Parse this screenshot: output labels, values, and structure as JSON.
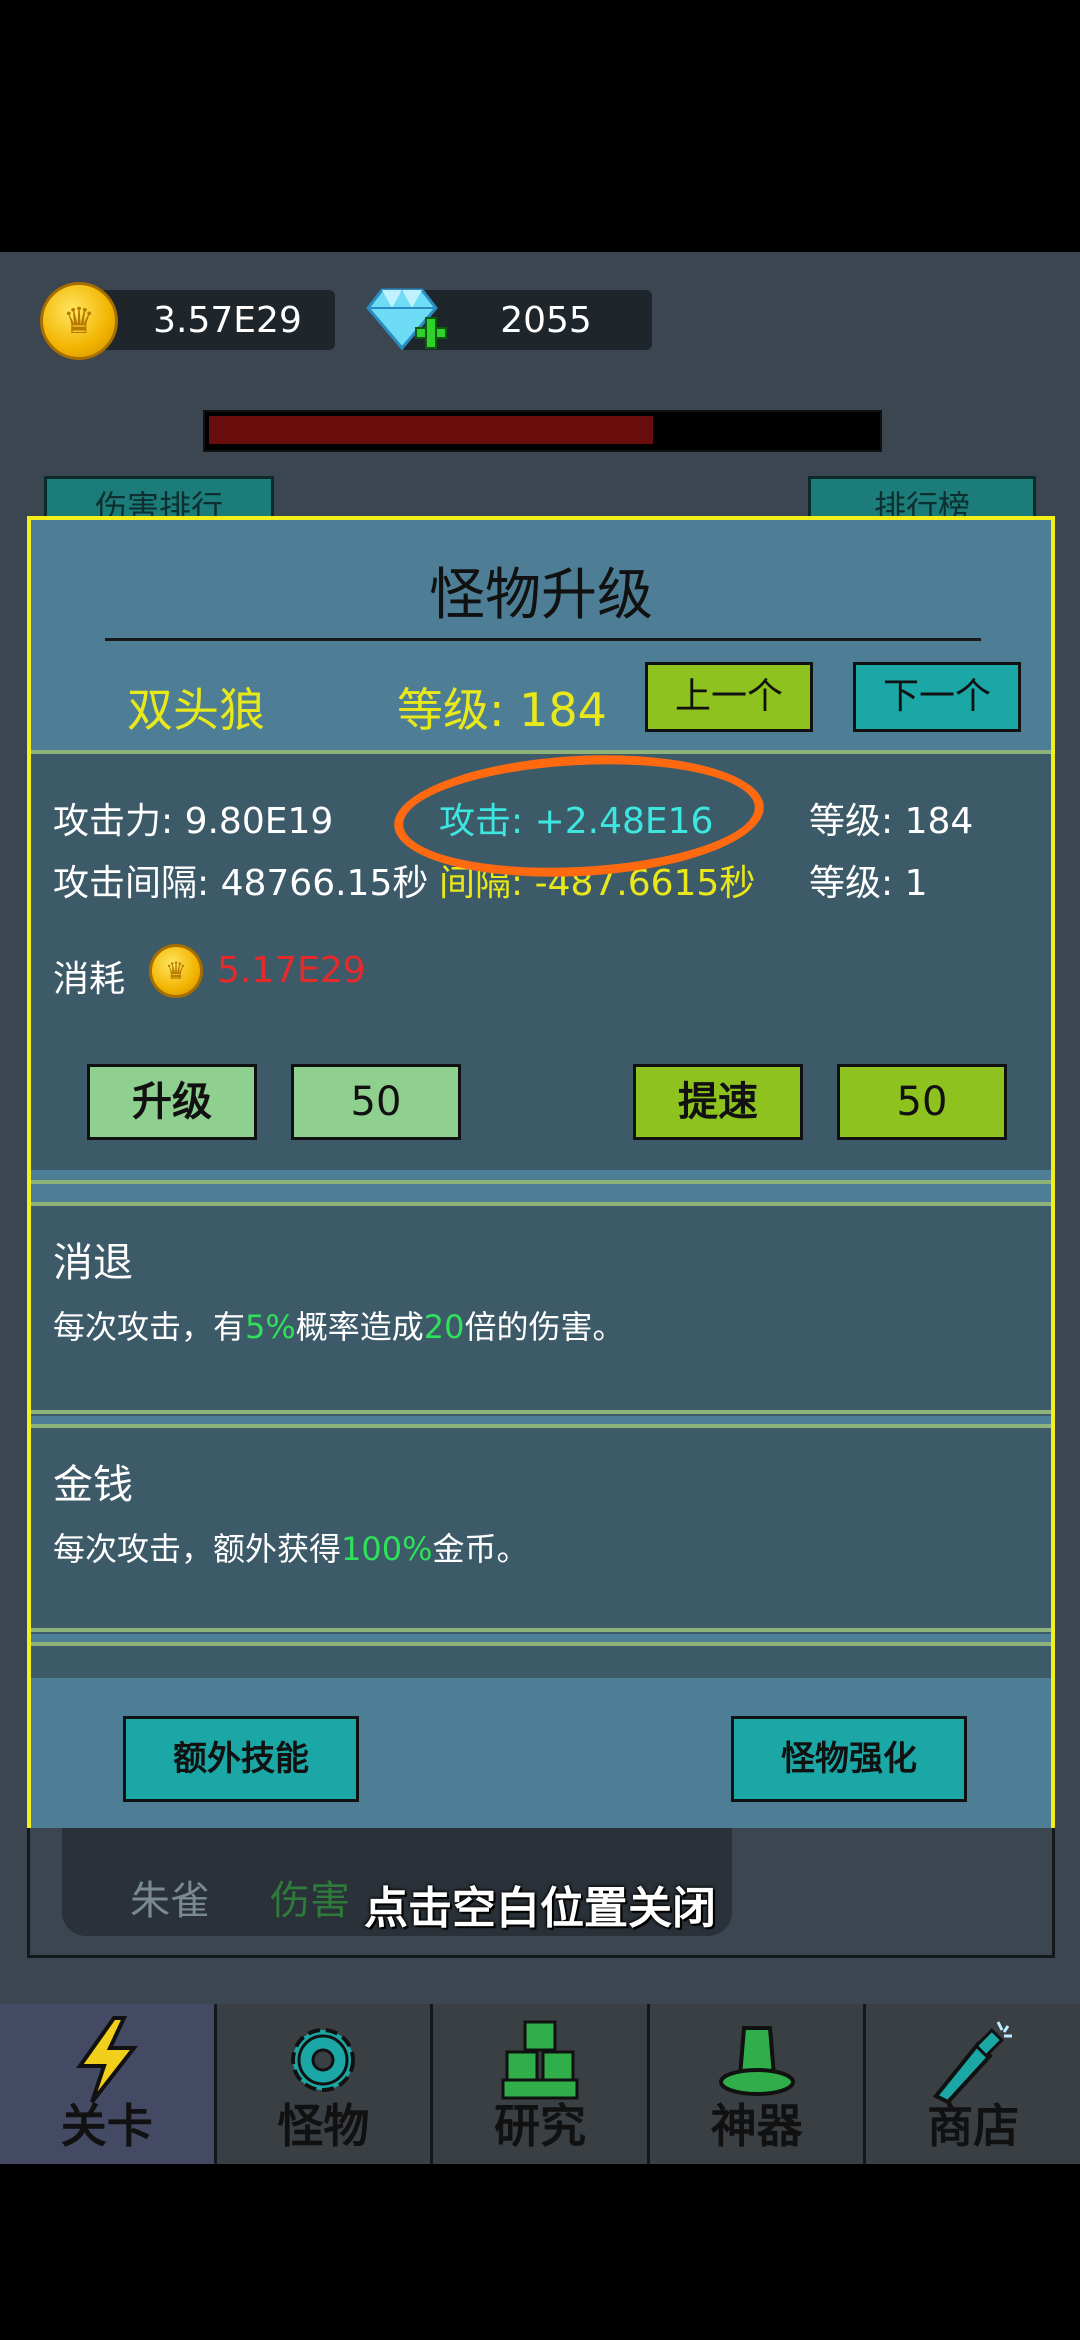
{
  "currency": {
    "gold": "3.57E29",
    "gems": "2055"
  },
  "hp_fraction": 0.67,
  "background": {
    "left_tab": "伤害排行",
    "right_tab": "排行榜",
    "list_name": "朱雀",
    "list_value": "伤害"
  },
  "dialog": {
    "title": "怪物升级",
    "monster_name": "双头狼",
    "monster_level": "等级: 184",
    "prev_button": "上一个",
    "next_button": "下一个",
    "stats": {
      "attack": "攻击力: 9.80E19",
      "attack_gain": "攻击: +2.48E16",
      "attack_level": "等级: 184",
      "interval": "攻击间隔: 48766.15秒",
      "interval_gain": "间隔: -487.6615秒",
      "interval_level": "等级: 1"
    },
    "cost_label": "消耗",
    "cost_value": "5.17E29",
    "upgrade_button": "升级",
    "upgrade_amount": "50",
    "speed_button": "提速",
    "speed_amount": "50",
    "skills": [
      {
        "title": "消退",
        "desc_prefix": "每次攻击，有",
        "pct": "5%",
        "desc_mid": "概率造成",
        "mult": "20",
        "desc_suffix": "倍的伤害。"
      },
      {
        "title": "金钱",
        "desc_prefix": "每次攻击，额外获得",
        "pct": "100%",
        "desc_suffix": "金币。"
      }
    ],
    "extra_skill_button": "额外技能",
    "enhance_button": "怪物强化"
  },
  "close_hint": "点击空白位置关闭",
  "nav": [
    {
      "label": "关卡",
      "icon": "lightning-icon"
    },
    {
      "label": "怪物",
      "icon": "gear-icon"
    },
    {
      "label": "研究",
      "icon": "blocks-icon"
    },
    {
      "label": "神器",
      "icon": "hat-icon"
    },
    {
      "label": "商店",
      "icon": "bottle-icon"
    }
  ],
  "colors": {
    "dialog_bg": "#4e7e95",
    "dialog_border": "#f2ef1a",
    "accent_green": "#8dc21f",
    "accent_teal": "#1ba7a6",
    "cost_red": "#e62a2a"
  }
}
